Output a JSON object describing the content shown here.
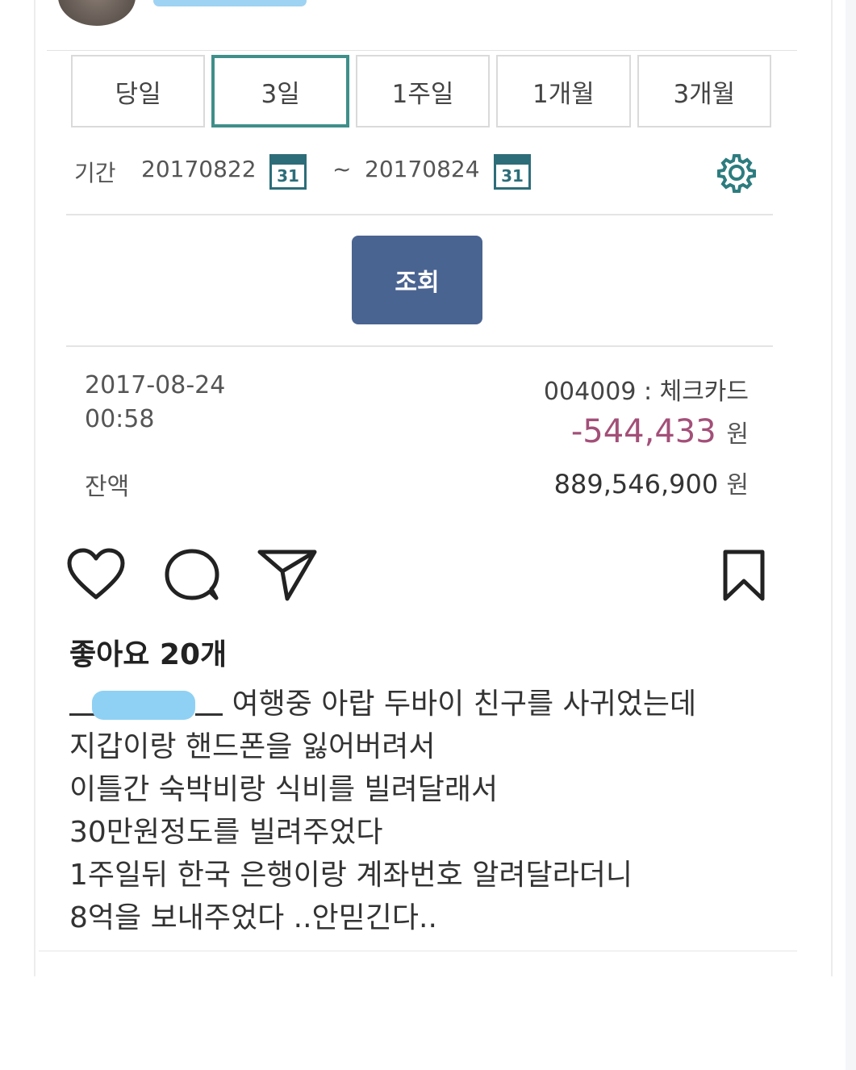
{
  "tabs": [
    {
      "label": "당일",
      "active": false
    },
    {
      "label": "3일",
      "active": true
    },
    {
      "label": "1주일",
      "active": false
    },
    {
      "label": "1개월",
      "active": false
    },
    {
      "label": "3개월",
      "active": false
    }
  ],
  "period": {
    "label": "기간",
    "start": "20170822",
    "separator": "~",
    "end": "20170824",
    "calendar_icon_text": "31"
  },
  "search_button": "조회",
  "transaction": {
    "date": "2017-08-24",
    "time": "00:58",
    "balance_label": "잔액",
    "card": "004009 : 체크카드",
    "amount": "-544,433",
    "amount_unit": "원",
    "balance": "889,546,900",
    "balance_unit": "원"
  },
  "post": {
    "likes": "좋아요 20개",
    "caption_lines": [
      "여행중 아랍 두바이 친구를 사귀었는데",
      "지갑이랑 핸드폰을 잃어버려서",
      "이틀간 숙박비랑 식비를 빌려달래서",
      "30만원정도를 빌려주었다",
      "1주일뒤 한국 은행이랑 계좌번호 알려달라더니",
      "8억을 보내주었다 ..안믿긴다.."
    ]
  },
  "icons": {
    "like": "heart-icon",
    "comment": "comment-icon",
    "share": "share-icon",
    "save": "bookmark-icon",
    "settings": "gear-icon",
    "calendar": "calendar-icon"
  },
  "colors": {
    "active_tab_border": "#3f8f8a",
    "search_button": "#4a6491",
    "amount": "#a34f78",
    "calendar": "#2d6d79",
    "redaction": "#8fd1f4"
  }
}
